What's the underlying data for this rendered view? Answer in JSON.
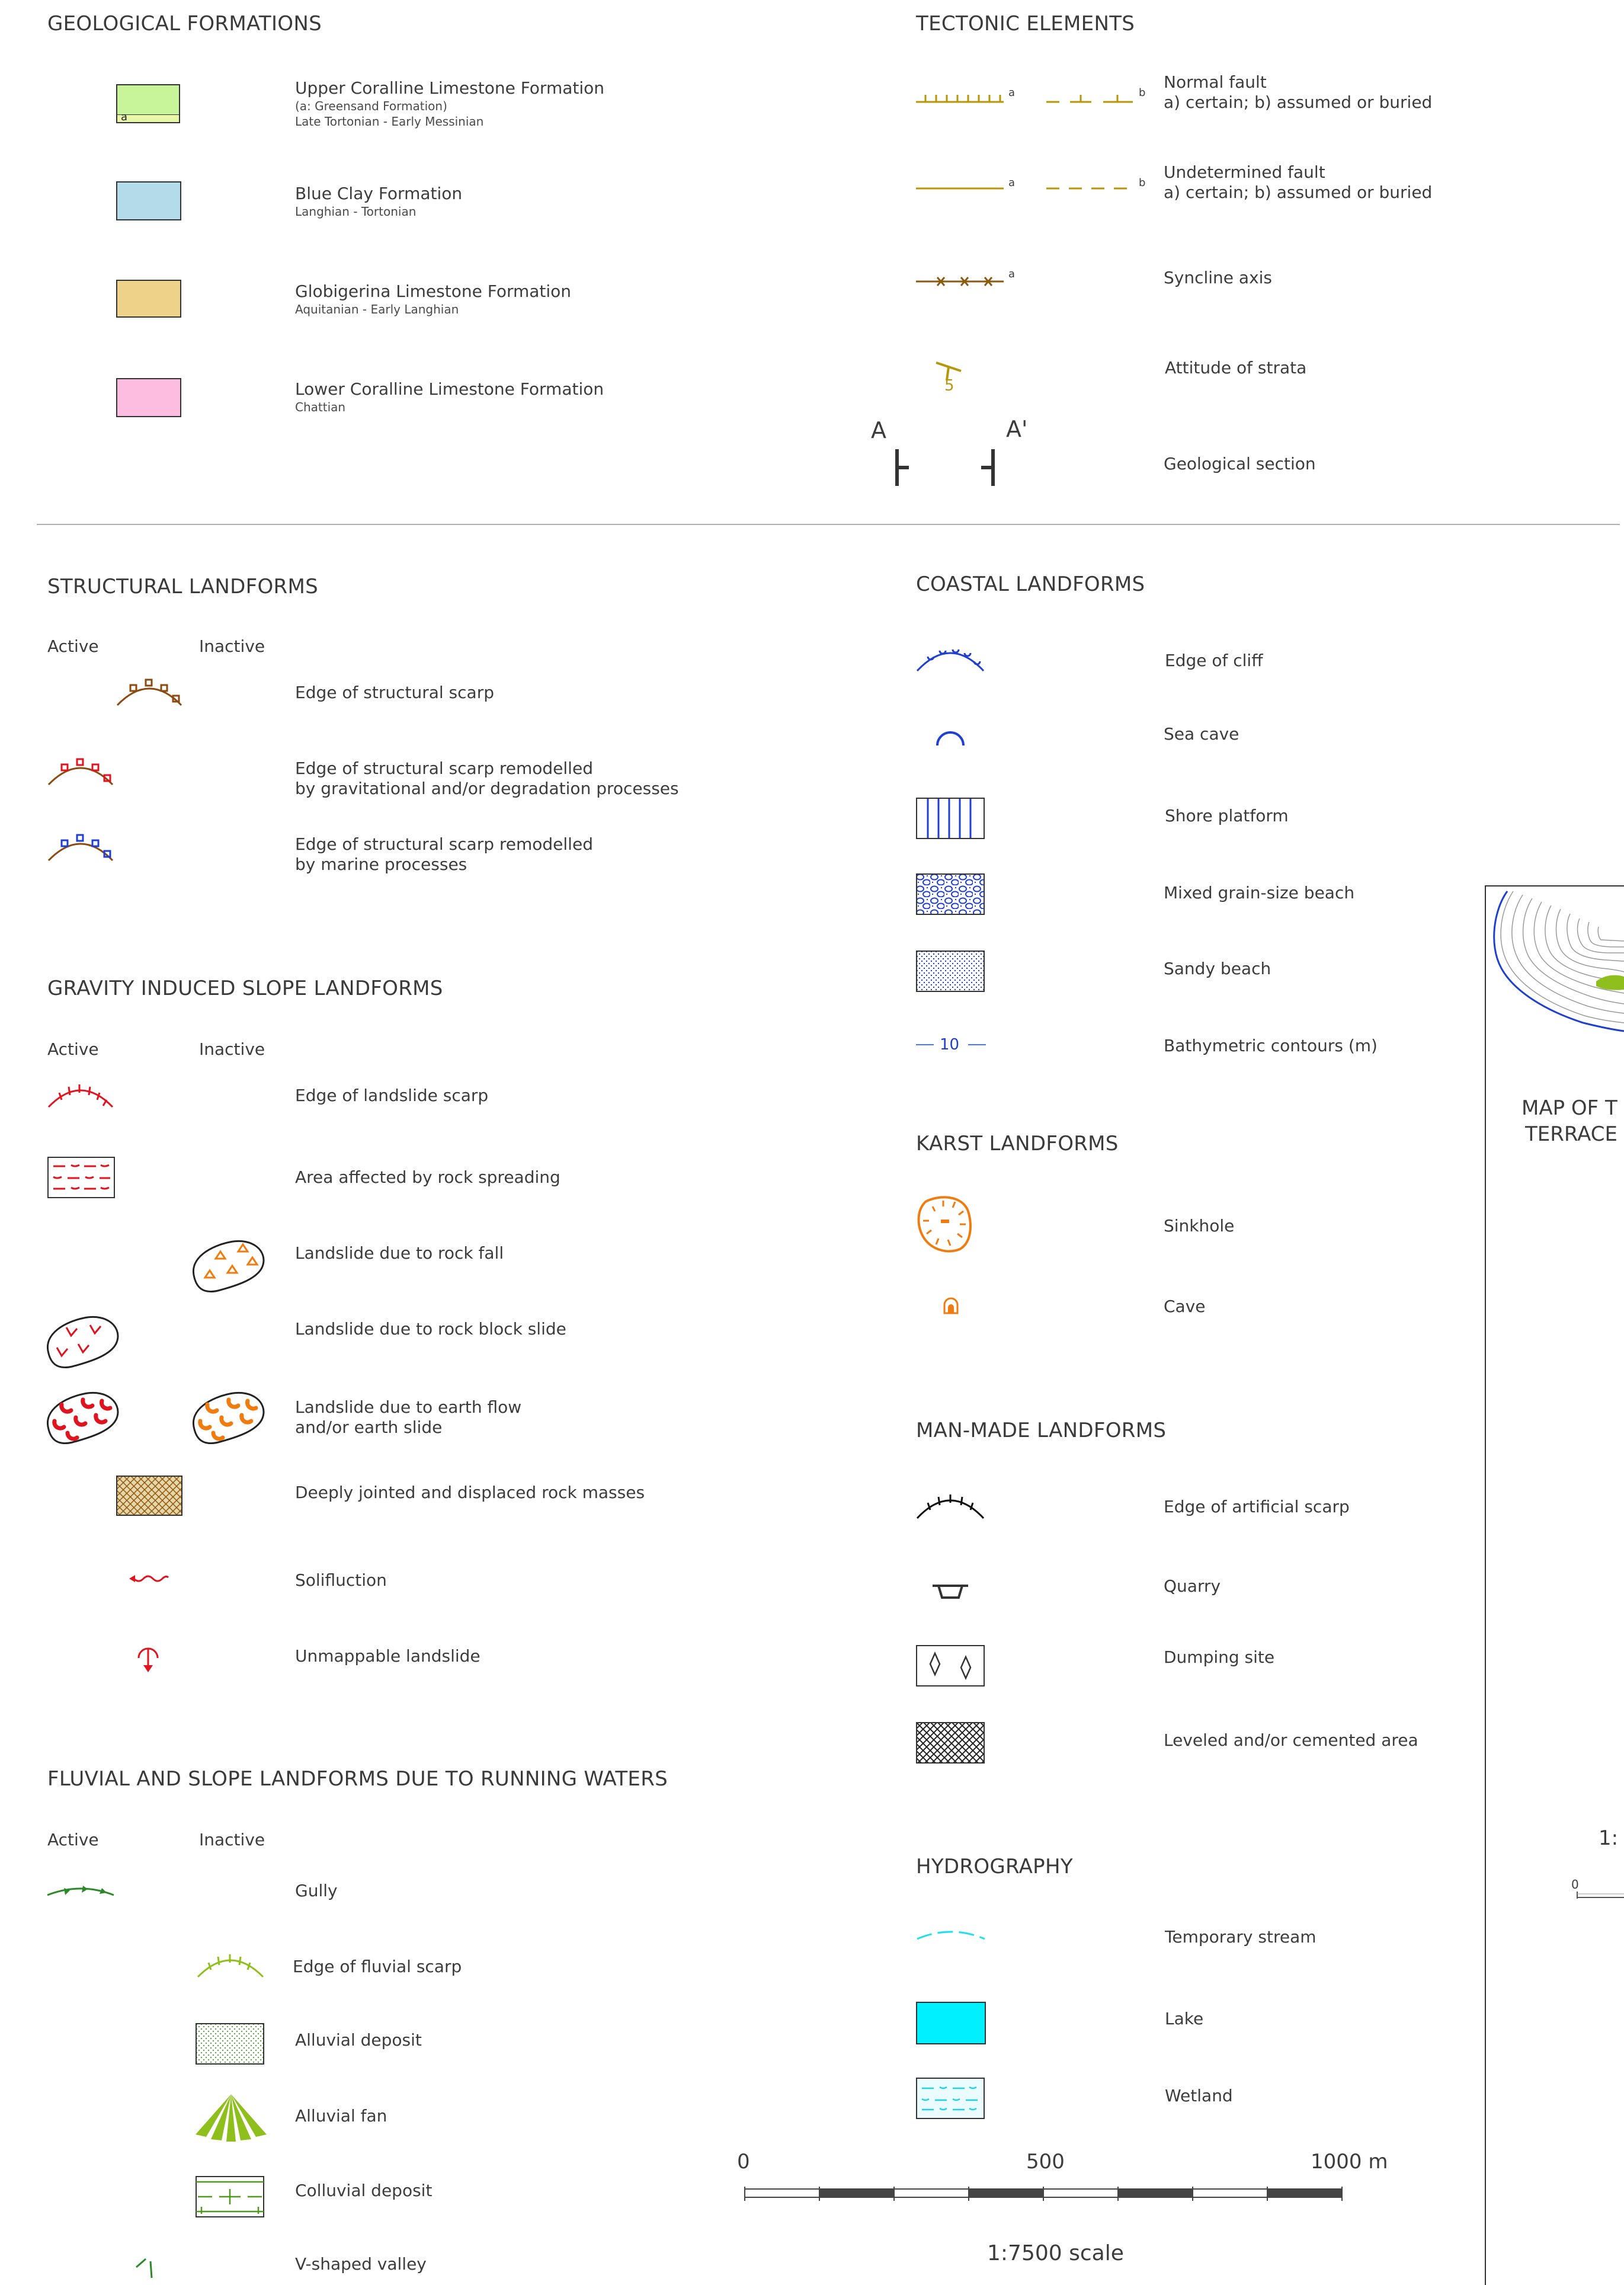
{
  "sections": {
    "geological_formations": "GEOLOGICAL FORMATIONS",
    "tectonic_elements": "TECTONIC ELEMENTS",
    "structural_landforms": "STRUCTURAL LANDFORMS",
    "coastal_landforms": "COASTAL LANDFORMS",
    "gravity_landforms": "GRAVITY INDUCED SLOPE LANDFORMS",
    "karst_landforms": "KARST LANDFORMS",
    "man_made_landforms": "MAN-MADE LANDFORMS",
    "fluvial_landforms": "FLUVIAL AND SLOPE LANDFORMS DUE TO RUNNING WATERS",
    "hydrography": "HYDROGRAPHY"
  },
  "column_headers": {
    "active": "Active",
    "inactive": "Inactive"
  },
  "formations": [
    {
      "name": "Upper Coralline Limestone Formation",
      "note": "(a: Greensand Formation)",
      "age": "Late Tortonian - Early Messinian",
      "color": "#c9f59a",
      "inset_label": "a"
    },
    {
      "name": "Blue Clay Formation",
      "age": "Langhian - Tortonian",
      "color": "#b3dbea"
    },
    {
      "name": "Globigerina Limestone Formation",
      "age": "Aquitanian - Early Langhian",
      "color": "#efd28a"
    },
    {
      "name": "Lower Coralline Limestone Formation",
      "age": "Chattian",
      "color": "#fdbde1"
    }
  ],
  "tectonic": {
    "normal_fault": {
      "line1": "Normal fault",
      "line2": "a) certain; b) assumed or buried",
      "a": "a",
      "b": "b"
    },
    "undetermined_fault": {
      "line1": "Undetermined fault",
      "line2": "a) certain; b) assumed or buried",
      "a": "a",
      "b": "b"
    },
    "syncline": {
      "label": "Syncline axis",
      "a": "a"
    },
    "attitude": {
      "label": "Attitude of strata",
      "value": "5"
    },
    "section": {
      "label": "Geological section",
      "start": "A",
      "end": "A'"
    }
  },
  "structural": [
    {
      "line1": "Edge of structural scarp"
    },
    {
      "line1": "Edge of structural scarp remodelled",
      "line2": "by gravitational and/or degradation processes"
    },
    {
      "line1": "Edge of structural scarp remodelled",
      "line2": "by marine processes"
    }
  ],
  "gravity": [
    {
      "line1": "Edge of landslide scarp"
    },
    {
      "line1": "Area affected by rock spreading"
    },
    {
      "line1": "Landslide due to rock fall"
    },
    {
      "line1": "Landslide due to rock block slide"
    },
    {
      "line1": "Landslide due to earth flow",
      "line2": "and/or earth slide"
    },
    {
      "line1": "Deeply jointed and displaced rock masses"
    },
    {
      "line1": "Solifluction"
    },
    {
      "line1": "Unmappable landslide"
    }
  ],
  "fluvial": [
    {
      "line1": "Gully"
    },
    {
      "line1": "Edge of fluvial scarp"
    },
    {
      "line1": "Alluvial deposit"
    },
    {
      "line1": "Alluvial fan"
    },
    {
      "line1": "Colluvial deposit"
    },
    {
      "line1": "V-shaped valley"
    }
  ],
  "coastal": [
    {
      "line1": "Edge of cliff"
    },
    {
      "line1": "Sea cave"
    },
    {
      "line1": "Shore platform"
    },
    {
      "line1": "Mixed grain-size beach"
    },
    {
      "line1": "Sandy beach"
    },
    {
      "line1": "Bathymetric contours (m)",
      "symbol_text": "10"
    }
  ],
  "karst": [
    {
      "line1": "Sinkhole"
    },
    {
      "line1": "Cave"
    }
  ],
  "man_made": [
    {
      "line1": "Edge of artificial scarp"
    },
    {
      "line1": "Quarry"
    },
    {
      "line1": "Dumping site"
    },
    {
      "line1": "Leveled and/or cemented area"
    }
  ],
  "hydrography": [
    {
      "line1": "Temporary stream"
    },
    {
      "line1": "Lake"
    },
    {
      "line1": "Wetland"
    }
  ],
  "scale_bar": {
    "tick_0": "0",
    "tick_mid": "500",
    "tick_end": "1000 m",
    "caption": "1:7500 scale"
  },
  "inset": {
    "title_line1": "MAP OF T",
    "title_line2": "TERRACE",
    "scale_frag": "1:",
    "zero": "0"
  },
  "colors": {
    "fault": "#b8960a",
    "structural": "#8b4a10",
    "red": "#e0141e",
    "blue": "#1f3fd0",
    "orange": "#f07c10",
    "green": "#4f9a1c",
    "olive": "#8fbf1c",
    "cyan": "#20e0f0",
    "lake": "#00f0ff"
  }
}
